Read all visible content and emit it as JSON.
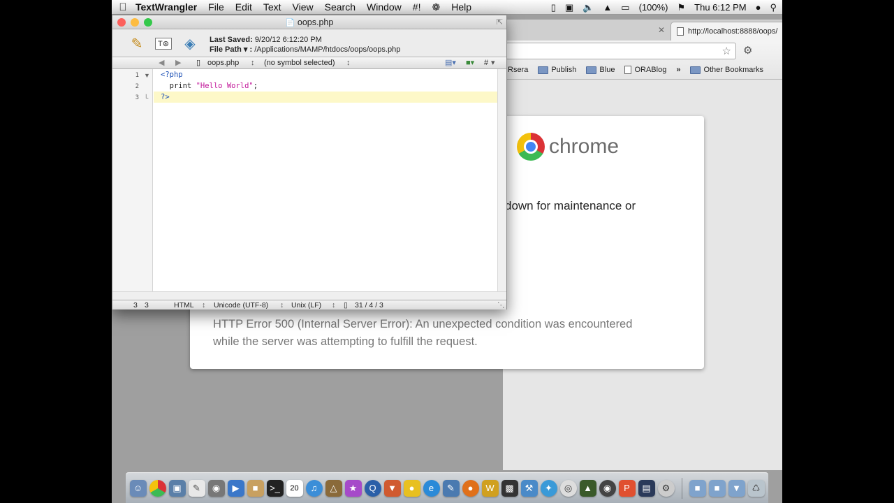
{
  "menubar": {
    "app_name": "TextWrangler",
    "menus": [
      "File",
      "Edit",
      "Text",
      "View",
      "Search",
      "Window",
      "#!",
      "Help"
    ],
    "battery": "(100%)",
    "clock": "Thu 6:12 PM"
  },
  "browser": {
    "tab_url": "http://localhost:8888/oops/",
    "bookmarks": [
      "Rsera",
      "Publish",
      "Blue",
      "ORABlog",
      "»",
      "Other Bookmarks"
    ],
    "logo_text": "chrome",
    "error_partial": "down for maintenance or",
    "error_http": "HTTP Error 500 (Internal Server Error): An unexpected condition was encountered while the server was attempting to fulfill the request."
  },
  "editor": {
    "window_title": "oops.php",
    "last_saved_label": "Last Saved:",
    "last_saved_value": "9/20/12 6:12:20 PM",
    "file_path_label": "File Path ▾ :",
    "file_path_value": "/Applications/MAMP/htdocs/oops/oops.php",
    "nav_file": "oops.php",
    "nav_symbol": "(no symbol selected)",
    "nav_hash": "#",
    "lines": [
      {
        "num": "1",
        "parts": [
          {
            "cls": "kw-tag",
            "text": "<?php"
          }
        ]
      },
      {
        "num": "2",
        "parts": [
          {
            "cls": "kw",
            "text": "  print "
          },
          {
            "cls": "str",
            "text": "\"Hello World\""
          },
          {
            "cls": "kw",
            "text": ";"
          }
        ]
      },
      {
        "num": "3",
        "parts": [
          {
            "cls": "kw-tag",
            "text": "?>"
          }
        ]
      }
    ],
    "status": {
      "line": "3",
      "col": "3",
      "language": "HTML",
      "encoding": "Unicode (UTF-8)",
      "line_endings": "Unix (LF)",
      "counts": "31 / 4 / 3"
    }
  },
  "colors": {
    "light_close": "#fc605c",
    "light_min": "#fdbc40",
    "light_zoom": "#34c84a"
  }
}
